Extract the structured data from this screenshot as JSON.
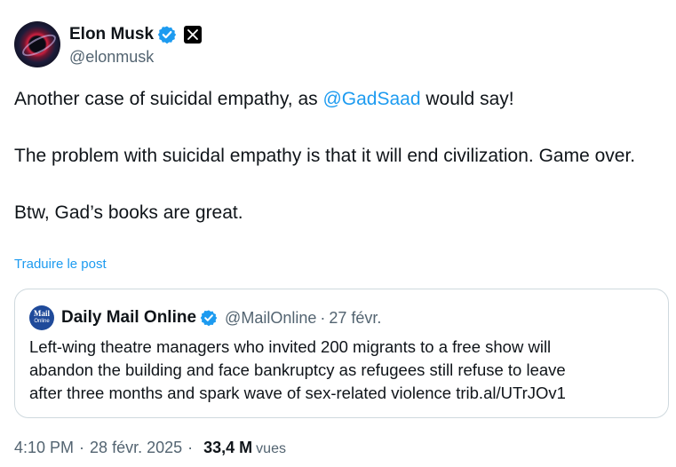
{
  "author": {
    "name": "Elon Musk",
    "handle": "@elonmusk",
    "verified_icon": "verified-badge-icon",
    "affiliation_icon": "x-logo-icon",
    "badge_color": "#1d9bf0"
  },
  "tweet": {
    "line1_before": "Another case of suicidal empathy, as ",
    "line1_mention": "@GadSaad",
    "line1_after": " would say!",
    "paragraph2": "The problem with suicidal empathy is that it will end civilization. Game over.",
    "paragraph3": "Btw, Gad’s books are great."
  },
  "translate_label": "Traduire le post",
  "quote": {
    "avatar_text_1": "Mail",
    "avatar_text_2": "Online",
    "name": "Daily Mail Online",
    "handle": "@MailOnline",
    "separator": "·",
    "time": "27 févr.",
    "line1": "Left-wing theatre managers who invited 200 migrants to a free show will",
    "line2": "abandon the building and face bankruptcy as refugees still refuse to leave",
    "line3": "after three months and spark wave of sex-related violence trib.al/UTrJOv1"
  },
  "meta": {
    "time": "4:10 PM",
    "separator": "·",
    "date": "28 févr. 2025",
    "views_count": "33,4 M",
    "views_label": "vues"
  },
  "colors": {
    "link": "#1d9bf0",
    "text": "#0f1419",
    "secondary": "#536471",
    "border": "#cfd9de"
  }
}
